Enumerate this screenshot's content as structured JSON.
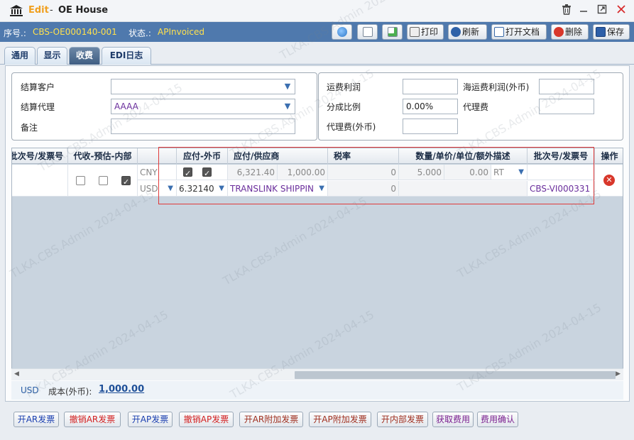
{
  "window": {
    "edit_label": "Edit",
    "separator": "-",
    "title": "OE House",
    "buttons": [
      "delete",
      "minimize",
      "maximize",
      "close"
    ]
  },
  "infobar": {
    "seq_label": "序号.:",
    "seq_value": "CBS-OE000140-001",
    "status_label": "状态.:",
    "status_value": "APInvoiced"
  },
  "toolbar": {
    "globe_icon": "globe-icon",
    "doc_icon": "document-icon",
    "export_icon": "export-icon",
    "print_label": "打印",
    "refresh_label": "刷新",
    "open_doc_label": "打开文档",
    "delete_label": "删除",
    "save_label": "保存"
  },
  "tabs": [
    "通用",
    "显示",
    "收费",
    "EDI日志"
  ],
  "active_tab": "收费",
  "form": {
    "settle_customer_label": "结算客户",
    "settle_customer_value": "",
    "settle_agent_label": "结算代理",
    "settle_agent_value": "AAAA",
    "remark_label": "备注",
    "remark_value": "",
    "freight_profit_label": "运费利润",
    "freight_profit_value": "",
    "ocean_profit_fc_label": "海运费利润(外币)",
    "ocean_profit_fc_value": "",
    "split_ratio_label": "分成比例",
    "split_ratio_value": "0.00%",
    "agency_fee_label": "代理费",
    "agency_fee_value": "",
    "agency_fee_fc_label": "代理费(外币)",
    "agency_fee_fc_value": ""
  },
  "grid": {
    "headers": [
      "批次号/发票号",
      "代收-预估-内部",
      "",
      "应付-外币",
      "应付/供应商",
      "税率",
      "数量/单价/单位/额外描述",
      "批次号/发票号",
      "操作"
    ],
    "row1": {
      "currency": "CNY",
      "amount": "6,321.40",
      "amount_fc": "1,000.00",
      "tax_rate": "0",
      "qty": "5.000",
      "unit_price": "0.00",
      "unit": "RT"
    },
    "row2": {
      "currency": "USD",
      "rate": "6.32140",
      "supplier": "TRANSLINK SHIPPIN",
      "tax_rate": "0",
      "invoice_no": "CBS-VI000331"
    },
    "checkboxes": {
      "collect": false,
      "estimate": false,
      "internal": true,
      "ap": true,
      "fc": true
    }
  },
  "footer": {
    "currency": "USD",
    "cost_label": "成本(外币):",
    "cost_value": "1,000.00"
  },
  "bottom_buttons": [
    {
      "label": "开AR发票",
      "color": "#1a3fb0"
    },
    {
      "label": "撤销AR发票",
      "color": "#d32020"
    },
    {
      "label": "开AP发票",
      "color": "#1a3fb0"
    },
    {
      "label": "撤销AP发票",
      "color": "#d32020"
    },
    {
      "label": "开AR附加发票",
      "color": "#a03020"
    },
    {
      "label": "开AP附加发票",
      "color": "#a03020"
    },
    {
      "label": "开内部发票",
      "color": "#a03020"
    },
    {
      "label": "获取费用",
      "color": "#7a1f8f"
    },
    {
      "label": "费用确认",
      "color": "#7a1f8f"
    }
  ],
  "watermark": "TLKA.CBS.Admin 2024-04-15"
}
